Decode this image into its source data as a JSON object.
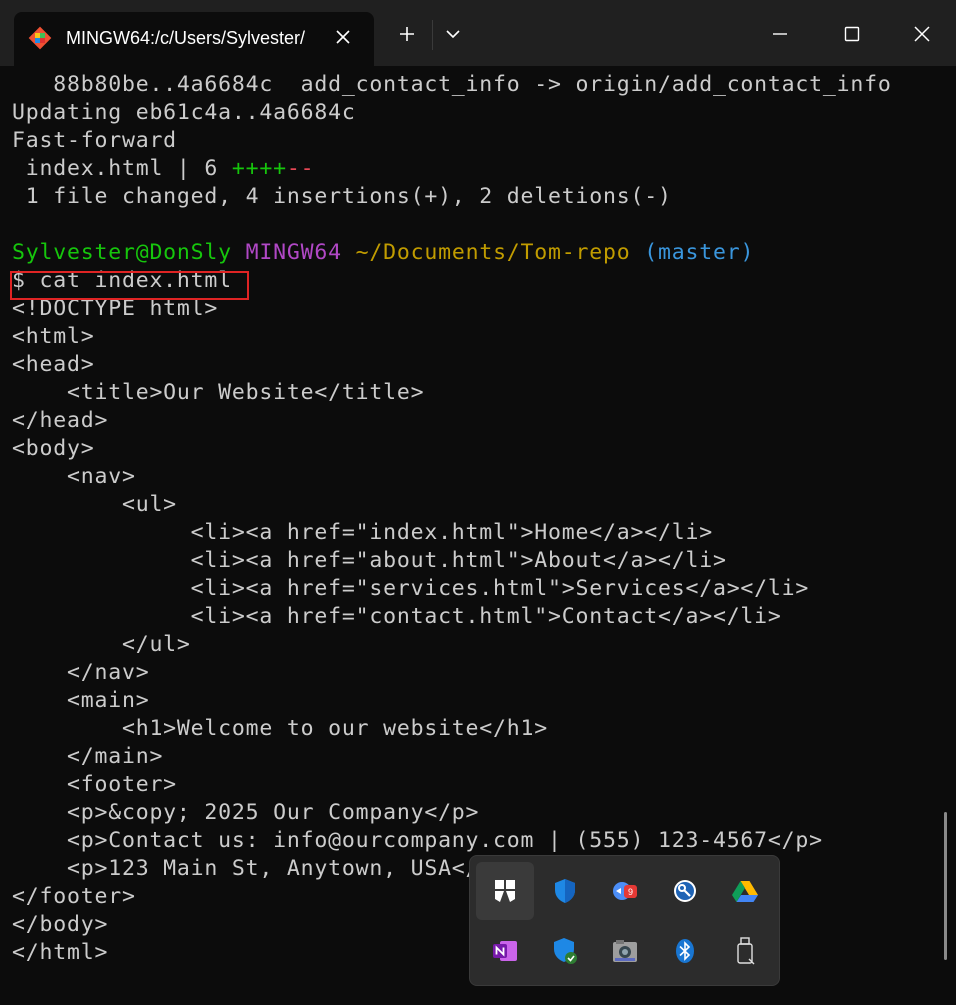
{
  "window": {
    "tab_title": "MINGW64:/c/Users/Sylvester/",
    "icons": [
      "git-icon",
      "close-icon",
      "plus-icon",
      "chevron-down-icon",
      "minimize-icon",
      "maximize-icon",
      "close-icon"
    ]
  },
  "terminal": {
    "lines": [
      "   88b80be..4a6684c  add_contact_info -> origin/add_contact_info",
      "Updating eb61c4a..4a6684c",
      "Fast-forward",
      {
        "segments": [
          {
            "t": " index.html | 6 "
          },
          {
            "t": "++++",
            "c": "g"
          },
          {
            "t": "--",
            "c": "r"
          }
        ]
      },
      " 1 file changed, 4 insertions(+), 2 deletions(-)",
      "",
      {
        "segments": [
          {
            "t": "Sylvester@DonSly",
            "c": "g"
          },
          {
            "t": " "
          },
          {
            "t": "MINGW64",
            "c": "m"
          },
          {
            "t": " "
          },
          {
            "t": "~/Documents/Tom-repo",
            "c": "y"
          },
          {
            "t": " "
          },
          {
            "t": "(master)",
            "c": "c"
          }
        ]
      },
      "$ cat index.html",
      "<!DOCTYPE html>",
      "<html>",
      "<head>",
      "    <title>Our Website</title>",
      "</head>",
      "<body>",
      "    <nav>",
      "        <ul>",
      "             <li><a href=\"index.html\">Home</a></li>",
      "             <li><a href=\"about.html\">About</a></li>",
      "             <li><a href=\"services.html\">Services</a></li>",
      "             <li><a href=\"contact.html\">Contact</a></li>",
      "        </ul>",
      "    </nav>",
      "    <main>",
      "        <h1>Welcome to our website</h1>",
      "    </main>",
      "    <footer>",
      "    <p>&copy; 2025 Our Company</p>",
      "    <p>Contact us: info@ourcompany.com | (555) 123-4567</p>",
      "    <p>123 Main St, Anytown, USA</p>",
      "</footer>",
      "</body>",
      "</html>"
    ],
    "colors": {
      "g": "#16c60c",
      "r": "#e74856",
      "m": "#b148c6",
      "y": "#c19c00",
      "c": "#3a96dd"
    }
  },
  "tray": {
    "items": [
      {
        "name": "windows-app-icon",
        "selected": true
      },
      {
        "name": "defender-shield-icon"
      },
      {
        "name": "chat-notification-icon",
        "badge": "9"
      },
      {
        "name": "key-tool-icon"
      },
      {
        "name": "google-drive-icon"
      },
      {
        "name": "onenote-icon"
      },
      {
        "name": "security-check-icon"
      },
      {
        "name": "webcam-app-icon"
      },
      {
        "name": "bluetooth-icon"
      },
      {
        "name": "usb-drive-icon"
      }
    ]
  }
}
